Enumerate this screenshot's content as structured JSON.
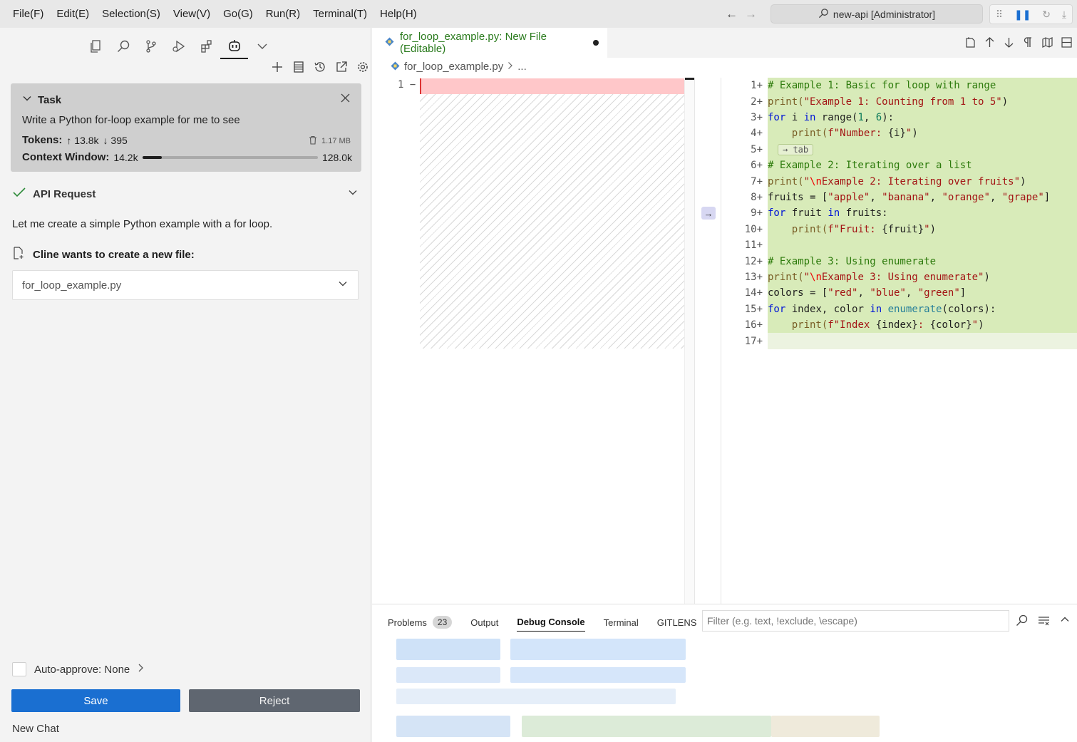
{
  "menubar": {
    "items": [
      "File(F)",
      "Edit(E)",
      "Selection(S)",
      "View(V)",
      "Go(G)",
      "Run(R)",
      "Terminal(T)",
      "Help(H)"
    ],
    "back_glyph": "←",
    "forward_glyph": "→",
    "search_text": "new-api [Administrator]"
  },
  "debug_toolbar": {
    "grip": "⠿",
    "pause": "❚❚",
    "restart": "↻",
    "step": "⤓"
  },
  "sidebar": {
    "task": {
      "title": "Task",
      "text": "Write a Python for-loop example for me to see",
      "tokens_label": "Tokens:",
      "tokens_in": "↑ 13.8k",
      "tokens_out": "↓ 395",
      "size": "1.17 MB",
      "context_label": "Context Window:",
      "context_used": "14.2k",
      "context_max": "128.0k",
      "context_fraction": 0.111
    },
    "api_request": {
      "label": "API Request",
      "message": "Let me create a simple Python example with a for loop."
    },
    "create_file": {
      "label": "Cline wants to create a new file:",
      "filename": "for_loop_example.py"
    },
    "auto_approve": "Auto-approve: None",
    "save_label": "Save",
    "reject_label": "Reject",
    "new_chat": "New Chat"
  },
  "editor": {
    "tab_title": "for_loop_example.py: New File (Editable)",
    "breadcrumb_file": "for_loop_example.py",
    "breadcrumb_more": "...",
    "left_line_number": "1",
    "left_marker": "−",
    "revert_arrow": "→",
    "tab_hint": "→ tab",
    "line_numbers": [
      "1",
      "2",
      "3",
      "4",
      "5",
      "6",
      "7",
      "8",
      "9",
      "10",
      "11",
      "12",
      "13",
      "14",
      "15",
      "16",
      "17"
    ],
    "added_marker": "+",
    "code": {
      "l1": "# Example 1: Basic for loop with range",
      "l2a": "print(",
      "l2b": "\"Example 1: Counting from 1 to 5\"",
      "l2c": ")",
      "l3a": "for",
      "l3b": " i ",
      "l3c": "in",
      "l3d": " range(",
      "l3e": "1",
      "l3f": ", ",
      "l3g": "6",
      "l3h": "):",
      "l4a": "    print(",
      "l4b": "f\"Number: ",
      "l4c": "{i}",
      "l4d": "\"",
      "l4e": ")",
      "l6": "# Example 2: Iterating over a list",
      "l7a": "print(",
      "l7b": "\"",
      "l7c": "\\n",
      "l7d": "Example 2: Iterating over fruits\"",
      "l7e": ")",
      "l8a": "fruits = [",
      "l8b": "\"apple\"",
      "l8c": ", ",
      "l8d": "\"banana\"",
      "l8e": ", ",
      "l8f": "\"orange\"",
      "l8g": ", ",
      "l8h": "\"grape\"",
      "l8i": "]",
      "l9a": "for",
      "l9b": " fruit ",
      "l9c": "in",
      "l9d": " fruits:",
      "l10a": "    print(",
      "l10b": "f\"Fruit: ",
      "l10c": "{fruit}",
      "l10d": "\"",
      "l10e": ")",
      "l12": "# Example 3: Using enumerate",
      "l13a": "print(",
      "l13b": "\"",
      "l13c": "\\n",
      "l13d": "Example 3: Using enumerate\"",
      "l13e": ")",
      "l14a": "colors = [",
      "l14b": "\"red\"",
      "l14c": ", ",
      "l14d": "\"blue\"",
      "l14e": ", ",
      "l14f": "\"green\"",
      "l14g": "]",
      "l15a": "for",
      "l15b": " index, color ",
      "l15c": "in",
      "l15d": " ",
      "l15e": "enumerate",
      "l15f": "(colors):",
      "l16a": "    print(",
      "l16b": "f\"Index ",
      "l16c": "{index}",
      "l16d": ": ",
      "l16e": "{color}",
      "l16f": "\"",
      "l16g": ")"
    }
  },
  "panel": {
    "tabs": {
      "problems": "Problems",
      "problems_count": "23",
      "output": "Output",
      "debug_console": "Debug Console",
      "terminal": "Terminal",
      "gitlens": "GITLENS"
    },
    "filter_placeholder": "Filter (e.g. text, !exclude, \\escape)"
  }
}
